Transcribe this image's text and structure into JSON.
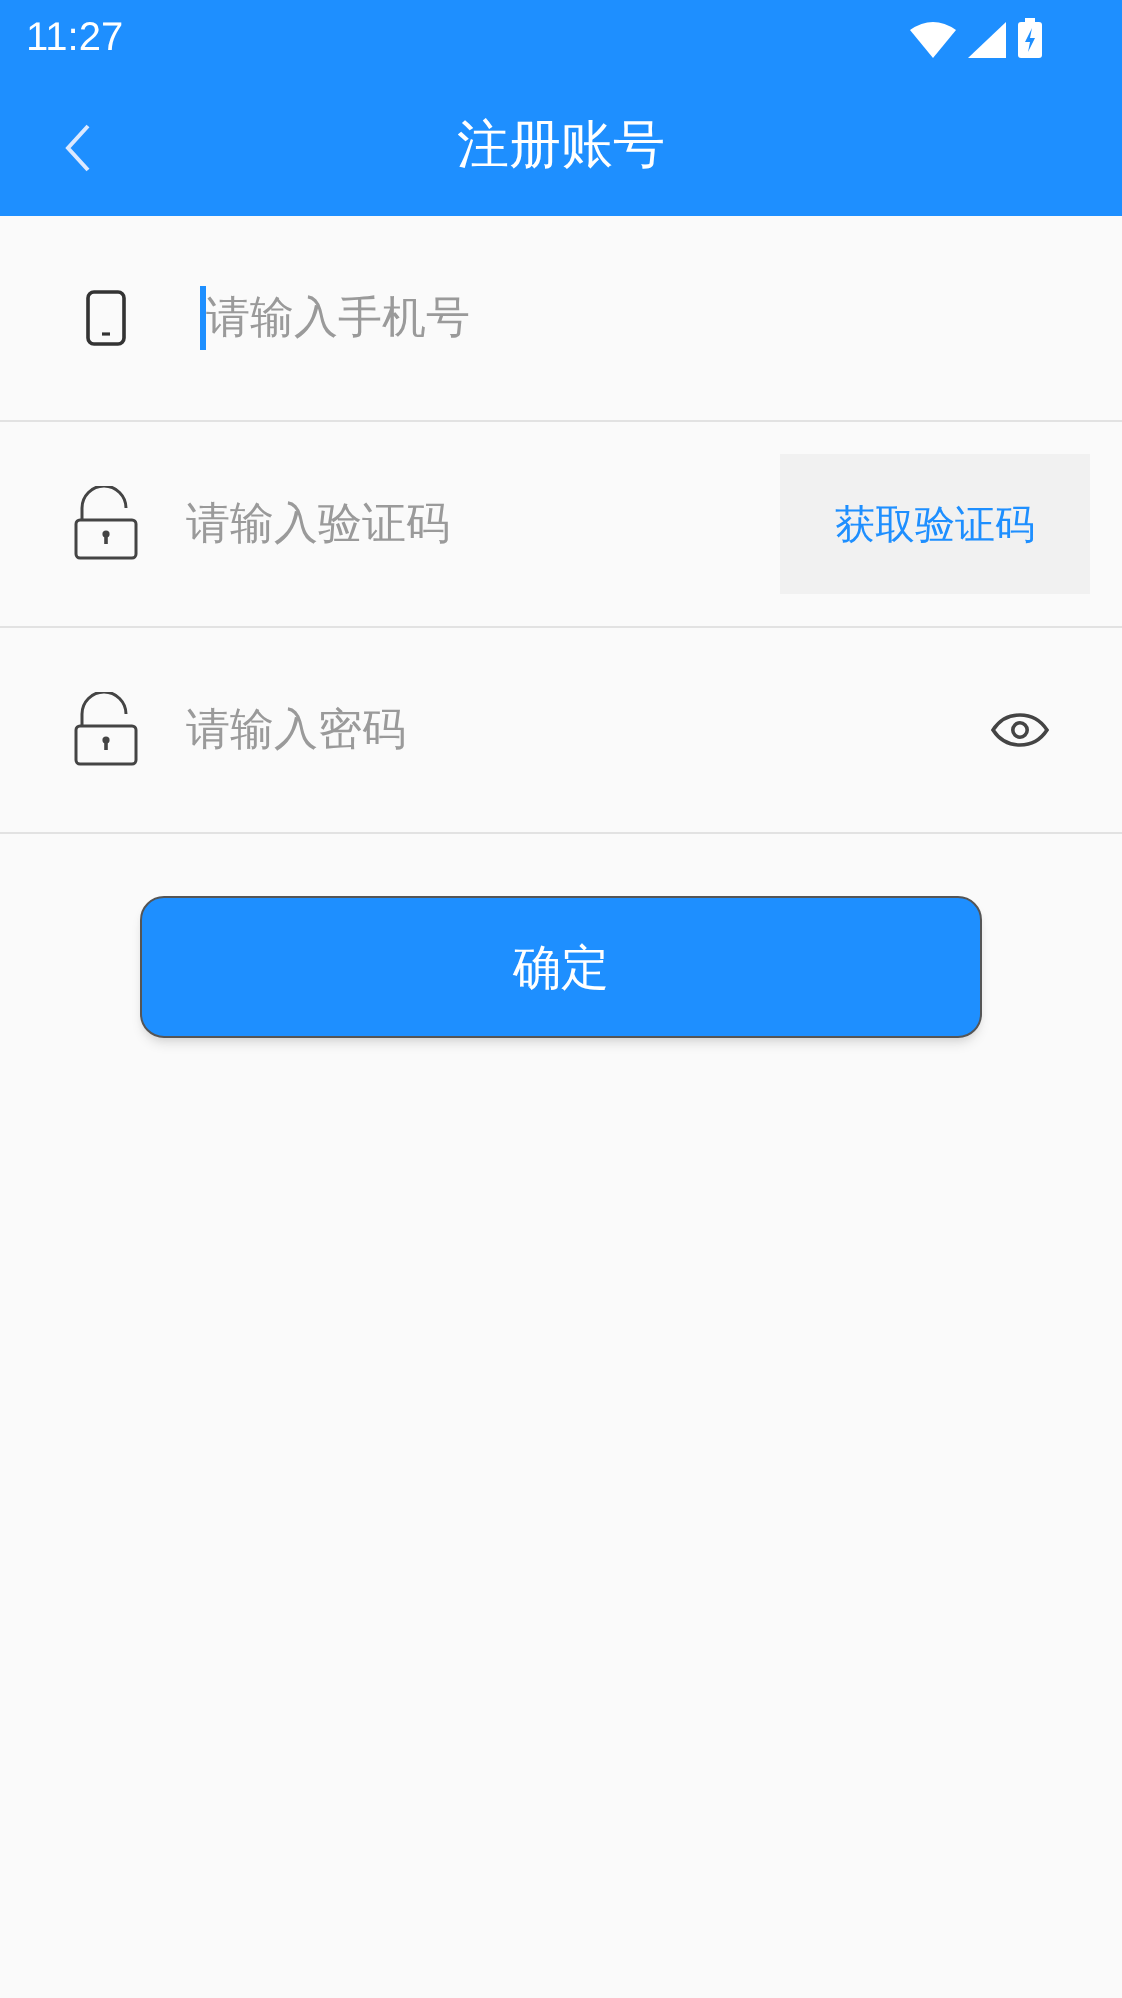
{
  "status_bar": {
    "time": "11:27"
  },
  "app_bar": {
    "title": "注册账号"
  },
  "fields": [
    {
      "kind": "phone",
      "placeholder": "请输入手机号",
      "focused": true
    },
    {
      "kind": "code",
      "placeholder": "请输入验证码",
      "focused": false,
      "action": "获取验证码"
    },
    {
      "kind": "password",
      "placeholder": "请输入密码",
      "focused": false
    }
  ],
  "submit": {
    "label": "确定"
  }
}
